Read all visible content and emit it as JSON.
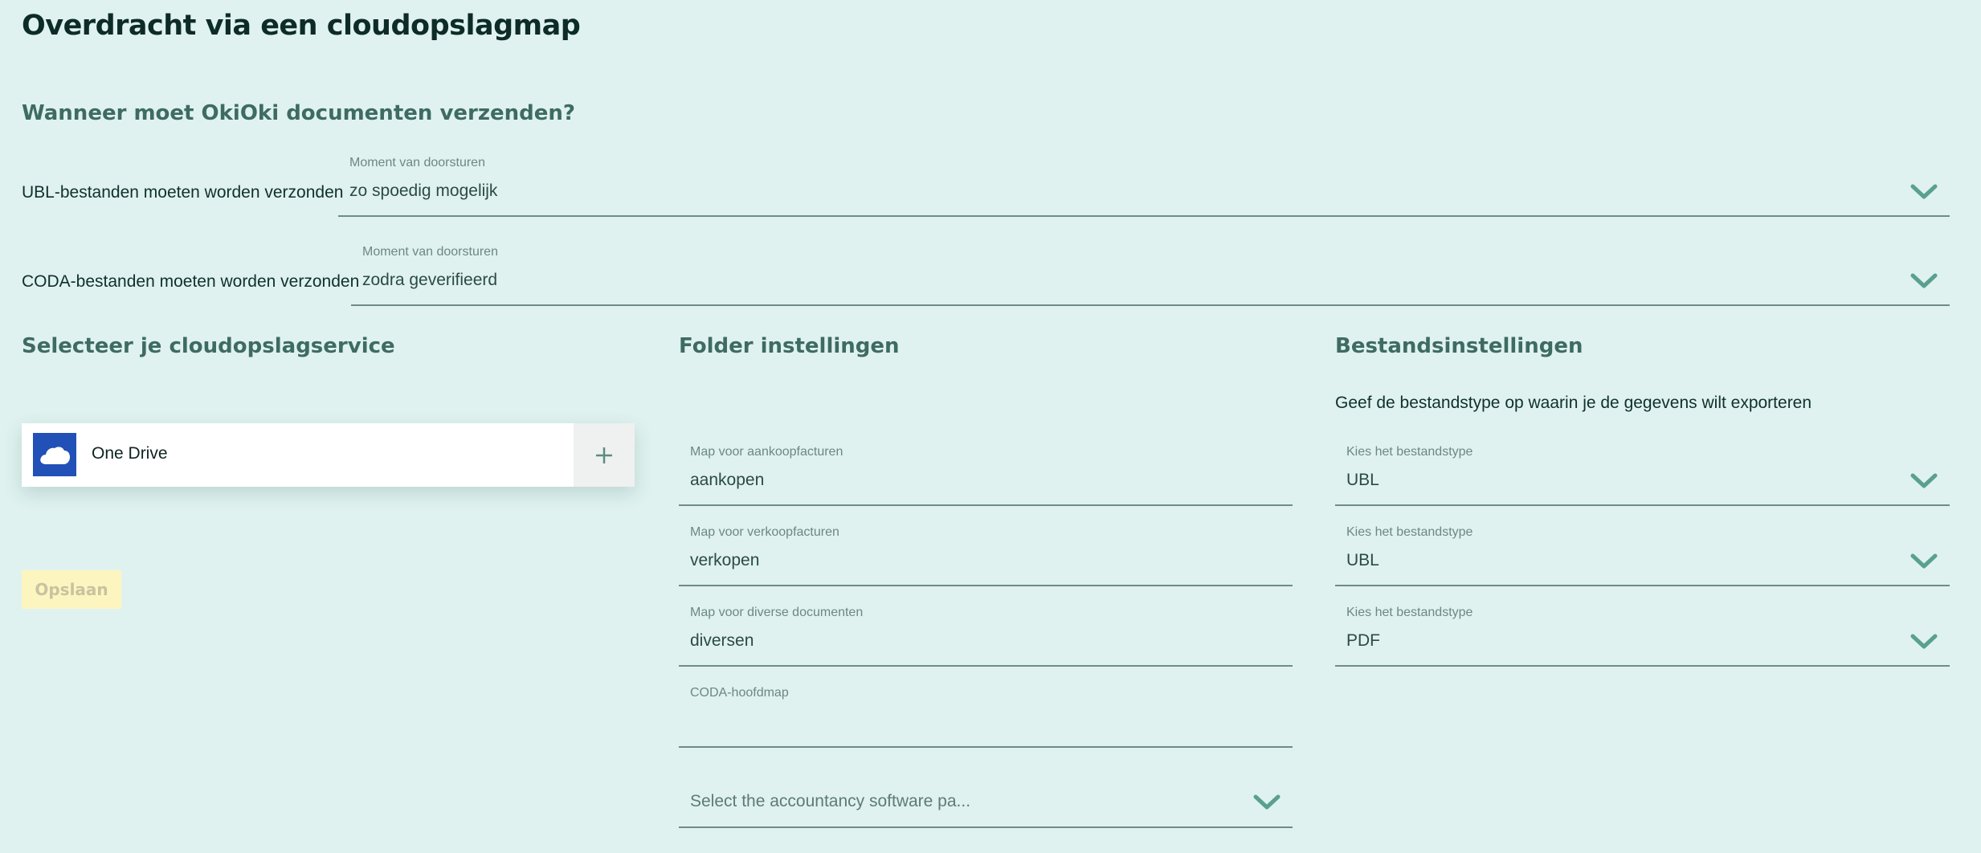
{
  "page": {
    "title": "Overdracht via een cloudopslagmap"
  },
  "schedule": {
    "title": "Wanneer moet OkiOki documenten verzenden?",
    "ubl": {
      "label": "UBL-bestanden moeten worden verzonden",
      "field_label": "Moment van doorsturen",
      "value": "zo spoedig mogelijk"
    },
    "coda": {
      "label": "CODA-bestanden moeten worden verzonden",
      "field_label": "Moment van doorsturen",
      "value": "zodra geverifieerd"
    }
  },
  "cloud": {
    "title": "Selecteer je cloudopslagservice",
    "service_name": "One Drive",
    "save_label": "Opslaan"
  },
  "folders": {
    "title": "Folder instellingen",
    "purchase": {
      "label": "Map voor aankoopfacturen",
      "value": "aankopen"
    },
    "sales": {
      "label": "Map voor verkoopfacturen",
      "value": "verkopen"
    },
    "misc": {
      "label": "Map voor diverse documenten",
      "value": "diversen"
    },
    "coda": {
      "label": "CODA-hoofdmap",
      "value": ""
    },
    "software_placeholder": "Select the accountancy software pa..."
  },
  "files": {
    "title": "Bestandsinstellingen",
    "description": "Geef de bestandstype op waarin je de gegevens wilt exporteren",
    "type1": {
      "label": "Kies het bestandstype",
      "value": "UBL"
    },
    "type2": {
      "label": "Kies het bestandstype",
      "value": "UBL"
    },
    "type3": {
      "label": "Kies het bestandstype",
      "value": "PDF"
    }
  },
  "icons": {
    "chevron": "chevron-down-icon",
    "cloud": "onedrive-cloud-icon",
    "plus": "plus-icon"
  },
  "colors": {
    "background": "#dff2f0",
    "accent": "#5aa090",
    "onedrive_blue": "#2150b6",
    "save_button_bg": "#fdf5bf"
  }
}
